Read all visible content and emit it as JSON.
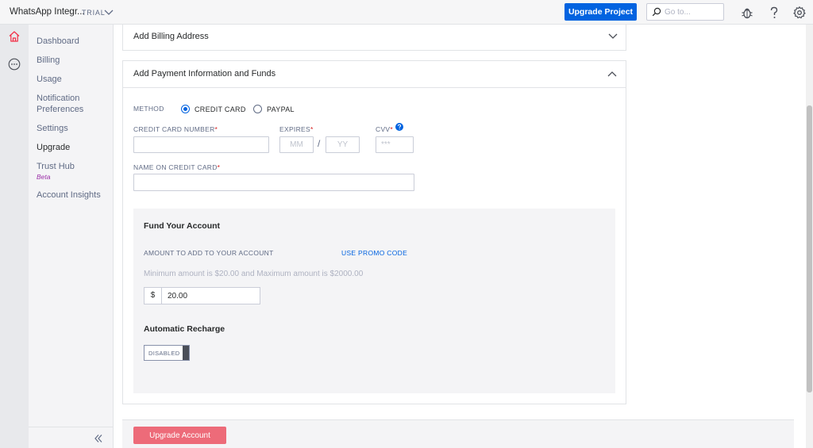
{
  "header": {
    "project_name": "WhatsApp Integr...",
    "project_badge": "TRIAL",
    "upgrade_label": "Upgrade Project",
    "search_placeholder": "Go to..."
  },
  "sidebar": {
    "items": [
      {
        "label": "Dashboard"
      },
      {
        "label": "Billing"
      },
      {
        "label": "Usage"
      },
      {
        "label": "Notification Preferences"
      },
      {
        "label": "Settings"
      },
      {
        "label": "Upgrade"
      },
      {
        "label": "Trust Hub",
        "badge": "Beta"
      },
      {
        "label": "Account Insights"
      }
    ]
  },
  "billing_address": {
    "title": "Add Billing Address"
  },
  "payment": {
    "title": "Add Payment Information and Funds",
    "method_label": "METHOD",
    "method_options": [
      "CREDIT CARD",
      "PAYPAL"
    ],
    "card_number_label": "CREDIT CARD NUMBER",
    "expires_label": "EXPIRES",
    "month_placeholder": "MM",
    "year_placeholder": "YY",
    "separator": "/",
    "cvv_label": "CVV",
    "cvv_placeholder": "***",
    "name_label": "NAME ON CREDIT CARD",
    "required_mark": "*"
  },
  "fund": {
    "title": "Fund Your Account",
    "amount_label": "AMOUNT TO ADD TO YOUR ACCOUNT",
    "promo_link": "USE PROMO CODE",
    "hint": "Minimum amount is $20.00 and Maximum amount is $2000.00",
    "currency": "$",
    "amount_value": "20.00",
    "recharge_title": "Automatic Recharge",
    "recharge_state": "DISABLED"
  },
  "footer": {
    "upgrade_account_label": "Upgrade Account"
  },
  "colors": {
    "primary": "#0263e0",
    "accent_home": "#f22f46",
    "submit_disabled": "#ed6b79"
  }
}
